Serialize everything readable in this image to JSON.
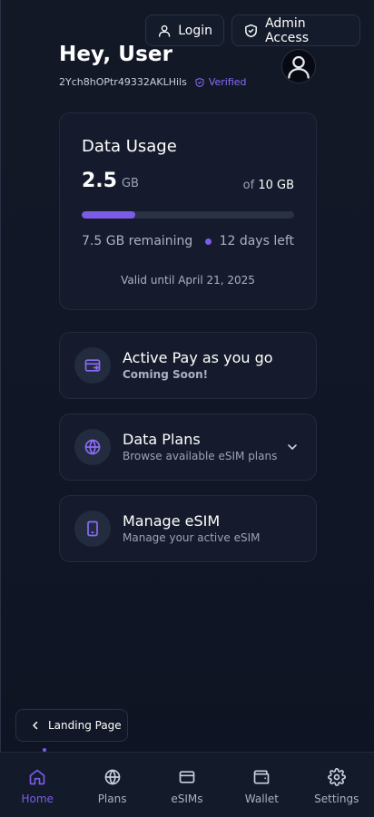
{
  "header": {
    "login_label": "Login",
    "admin_label": "Admin Access"
  },
  "user": {
    "greeting": "Hey, User",
    "id": "2Ych8hOPtr49332AKLHils",
    "verified_label": "Verified"
  },
  "usage": {
    "title": "Data Usage",
    "used_value": "2.5",
    "used_unit": "GB",
    "total_prefix": "of",
    "total": "10 GB",
    "used_fraction": 0.25,
    "remaining_text": "7.5 GB remaining",
    "days_left_text": "12 days left",
    "valid_text": "Valid until April 21, 2025"
  },
  "menu": [
    {
      "title": "Active Pay as you go",
      "subtitle": "Coming Soon!",
      "icon": "card-transfer-icon"
    },
    {
      "title": "Data Plans",
      "subtitle": "Browse available eSIM plans",
      "icon": "globe-icon"
    },
    {
      "title": "Manage eSIM",
      "subtitle": "Manage your active eSIM",
      "icon": "phone-icon"
    }
  ],
  "landing_label": "Landing Page",
  "nav": [
    {
      "label": "Home",
      "icon": "home-icon",
      "active": true
    },
    {
      "label": "Plans",
      "icon": "globe-icon",
      "active": false
    },
    {
      "label": "eSIMs",
      "icon": "card-icon",
      "active": false
    },
    {
      "label": "Wallet",
      "icon": "wallet-icon",
      "active": false
    },
    {
      "label": "Settings",
      "icon": "gear-icon",
      "active": false
    }
  ],
  "colors": {
    "accent": "#7c5ce6",
    "background": "#111726",
    "card": "#151b2c"
  }
}
